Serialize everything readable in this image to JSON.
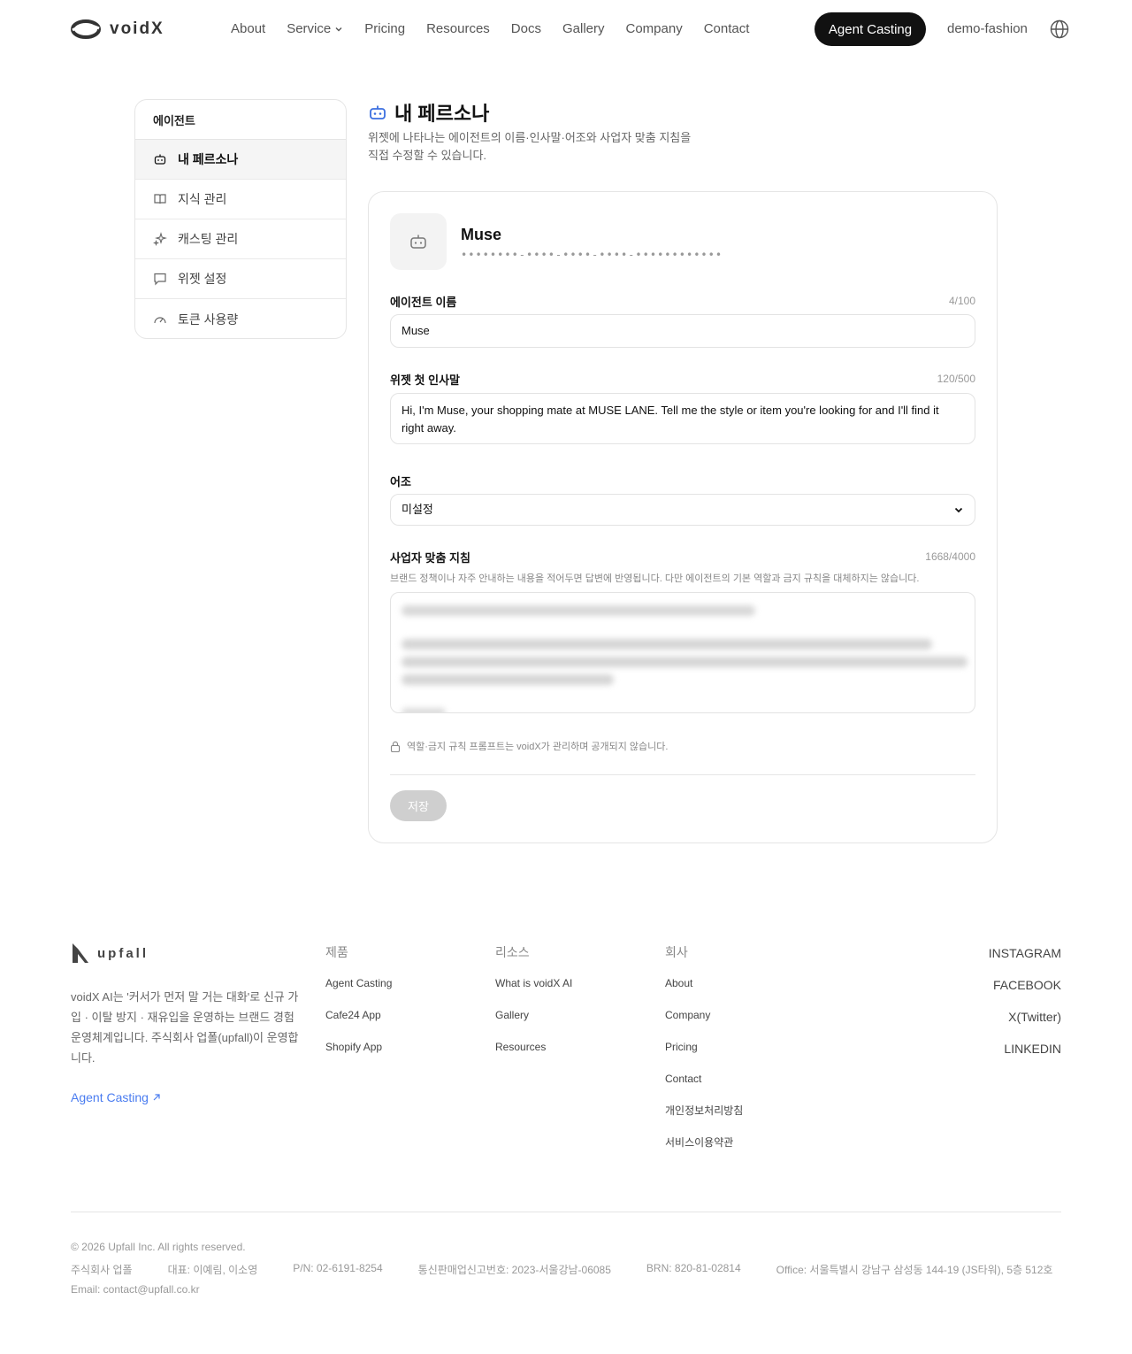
{
  "header": {
    "logo_text": "voidX",
    "nav": [
      {
        "label": "About"
      },
      {
        "label": "Service"
      },
      {
        "label": "Pricing"
      },
      {
        "label": "Resources"
      },
      {
        "label": "Docs"
      },
      {
        "label": "Gallery"
      },
      {
        "label": "Company"
      },
      {
        "label": "Contact"
      }
    ],
    "cta_label": "Agent Casting",
    "user": "demo-fashion"
  },
  "sidebar": {
    "title": "에이전트",
    "items": [
      {
        "label": "내 페르소나",
        "icon": "robot-icon"
      },
      {
        "label": "지식 관리",
        "icon": "book-icon"
      },
      {
        "label": "캐스팅 관리",
        "icon": "sparkle-icon"
      },
      {
        "label": "위젯 설정",
        "icon": "chat-icon"
      },
      {
        "label": "토큰 사용량",
        "icon": "gauge-icon"
      }
    ]
  },
  "main": {
    "title": "내 페르소나",
    "description": "위젯에 나타나는 에이전트의 이름·인사말·어조와 사업자 맞춤 지침을 직접 수정할 수 있습니다."
  },
  "card": {
    "agent_name": "Muse",
    "agent_id": "••••••••-••••-••••-••••-••••••••••••",
    "name_label": "에이전트 이름",
    "name_count": "4/100",
    "name_value": "Muse",
    "greeting_label": "위젯 첫 인사말",
    "greeting_count": "120/500",
    "greeting_value": "Hi, I'm Muse, your shopping mate at MUSE LANE. Tell me the style or item you're looking for and I'll find it right away.",
    "tone_label": "어조",
    "tone_value": "미설정",
    "instructions_label": "사업자 맞춤 지침",
    "instructions_count": "1668/4000",
    "instructions_help": "브랜드 정책이나 자주 안내하는 내용을 적어두면 답변에 반영됩니다. 다만 에이전트의 기본 역할과 금지 규칙을 대체하지는 않습니다.",
    "lock_note": "역할·금지 규칙 프롬프트는 voidX가 관리하며 공개되지 않습니다.",
    "save_label": "저장"
  },
  "footer": {
    "logo_text": "upfall",
    "description": "voidX AI는 '커서가 먼저 말 거는 대화'로 신규 가입 · 이탈 방지 · 재유입을 운영하는 브랜드 경험 운영체계입니다. 주식회사 업폴(upfall)이 운영합니다.",
    "cta_label": "Agent Casting",
    "columns": [
      {
        "title": "제품",
        "items": [
          "Agent Casting",
          "Cafe24 App",
          "Shopify App"
        ]
      },
      {
        "title": "리소스",
        "items": [
          "What is voidX AI",
          "Gallery",
          "Resources"
        ]
      },
      {
        "title": "회사",
        "items": [
          "About",
          "Company",
          "Pricing",
          "Contact",
          "개인정보처리방침",
          "서비스이용약관"
        ]
      }
    ],
    "social": [
      "INSTAGRAM",
      "FACEBOOK",
      "X(Twitter)",
      "LINKEDIN"
    ],
    "copyright": "© 2026 Upfall Inc. All rights reserved.",
    "company": "주식회사 업폴",
    "ceo": "대표: 이예림, 이소영",
    "phone": "P/N: 02-6191-8254",
    "mail_order": "통신판매업신고번호: 2023-서울강남-06085",
    "brn": "BRN: 820-81-02814",
    "office": "Office: 서울특별시 강남구 삼성동 144-19 (JS타워), 5층 512호",
    "email": "Email: contact@upfall.co.kr"
  }
}
